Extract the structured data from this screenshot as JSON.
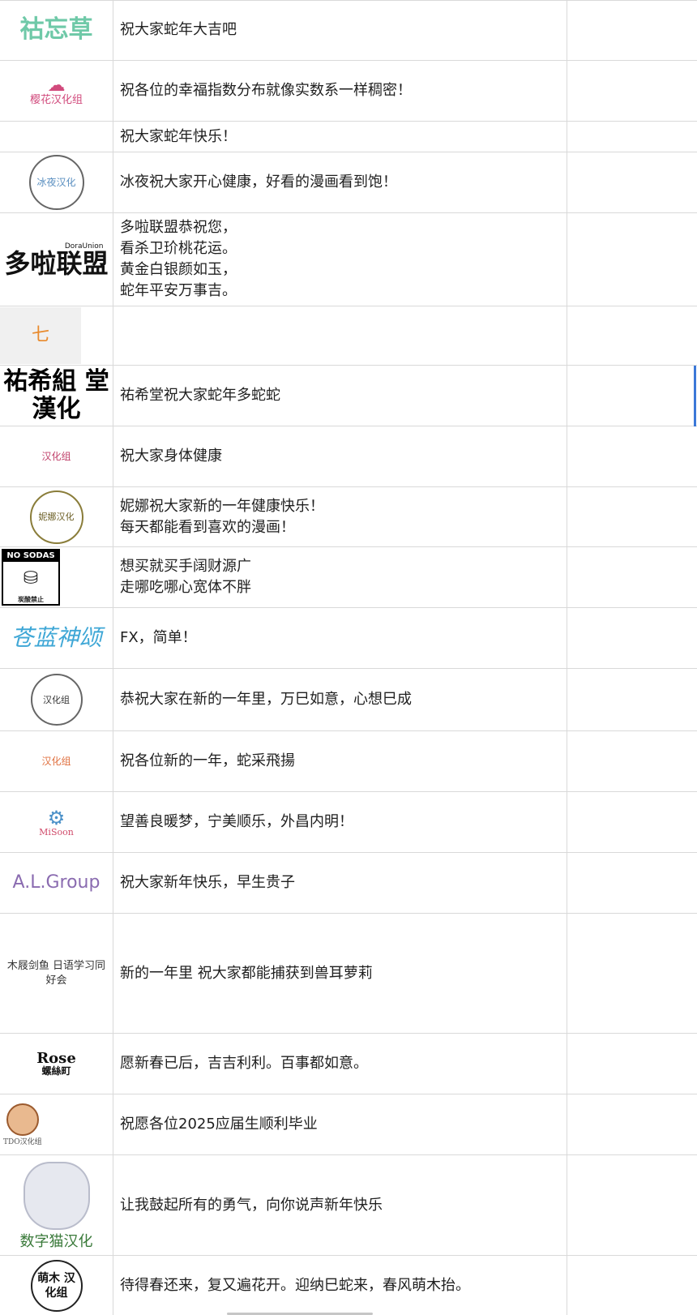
{
  "rows": [
    {
      "logo": "祜忘草",
      "message": "祝大家蛇年大吉吧"
    },
    {
      "logo": "樱花汉化组",
      "message": "祝各位的幸福指数分布就像实数系一样稠密！"
    },
    {
      "logo": "",
      "message": "祝大家蛇年快乐！"
    },
    {
      "logo": "冰夜汉化",
      "message": "冰夜祝大家开心健康，好看的漫画看到饱！"
    },
    {
      "logo": "多啦联盟",
      "logo_sub": "DoraUnion",
      "message": "多啦联盟恭祝您，\n看杀卫玠桃花运。\n黄金白银颜如玉，\n蛇年平安万事吉。"
    },
    {
      "logo": "七",
      "message": ""
    },
    {
      "logo": "祐希組 堂漢化",
      "message": "祐希堂祝大家蛇年多蛇蛇"
    },
    {
      "logo": "汉化组",
      "message": "祝大家身体健康"
    },
    {
      "logo": "妮娜汉化",
      "message": "妮娜祝大家新的一年健康快乐！\n每天都能看到喜欢的漫画！"
    },
    {
      "logo": "NO SODAS",
      "logo_sub": "炭酸禁止",
      "message": "想买就买手阔财源广\n走哪吃哪心宽体不胖"
    },
    {
      "logo": "苍蓝神颂",
      "message": "FX，简单！"
    },
    {
      "logo": "汉化组",
      "message": "恭祝大家在新的一年里，万巳如意，心想巳成"
    },
    {
      "logo": "汉化组",
      "message": "祝各位新的一年，蛇采飛揚"
    },
    {
      "logo": "MiSoon",
      "message": "望善良暖梦，宁美顺乐，外昌内明！"
    },
    {
      "logo": "A.L.Group",
      "message": "祝大家新年快乐，早生贵子"
    },
    {
      "logo": "木屐剑鱼 日语学习同好会",
      "message": "新的一年里 祝大家都能捕获到兽耳萝莉"
    },
    {
      "logo": "Rose",
      "logo_sub": "螺絲町",
      "message": "愿新春已后，吉吉利利。百事都如意。"
    },
    {
      "logo": "TDO汉化组",
      "message": "祝愿各位2025应届生顺利毕业"
    },
    {
      "logo": "数字猫汉化",
      "message": "让我鼓起所有的勇气，向你说声新年快乐"
    },
    {
      "logo": "萌木 汉化组",
      "message": "待得春还来，复又遍花开。迎纳巳蛇来，春风萌木抬。"
    }
  ],
  "colors": {
    "grid": "#d9d9d9",
    "selection": "#3b78d8",
    "text": "#1f1f1f"
  }
}
